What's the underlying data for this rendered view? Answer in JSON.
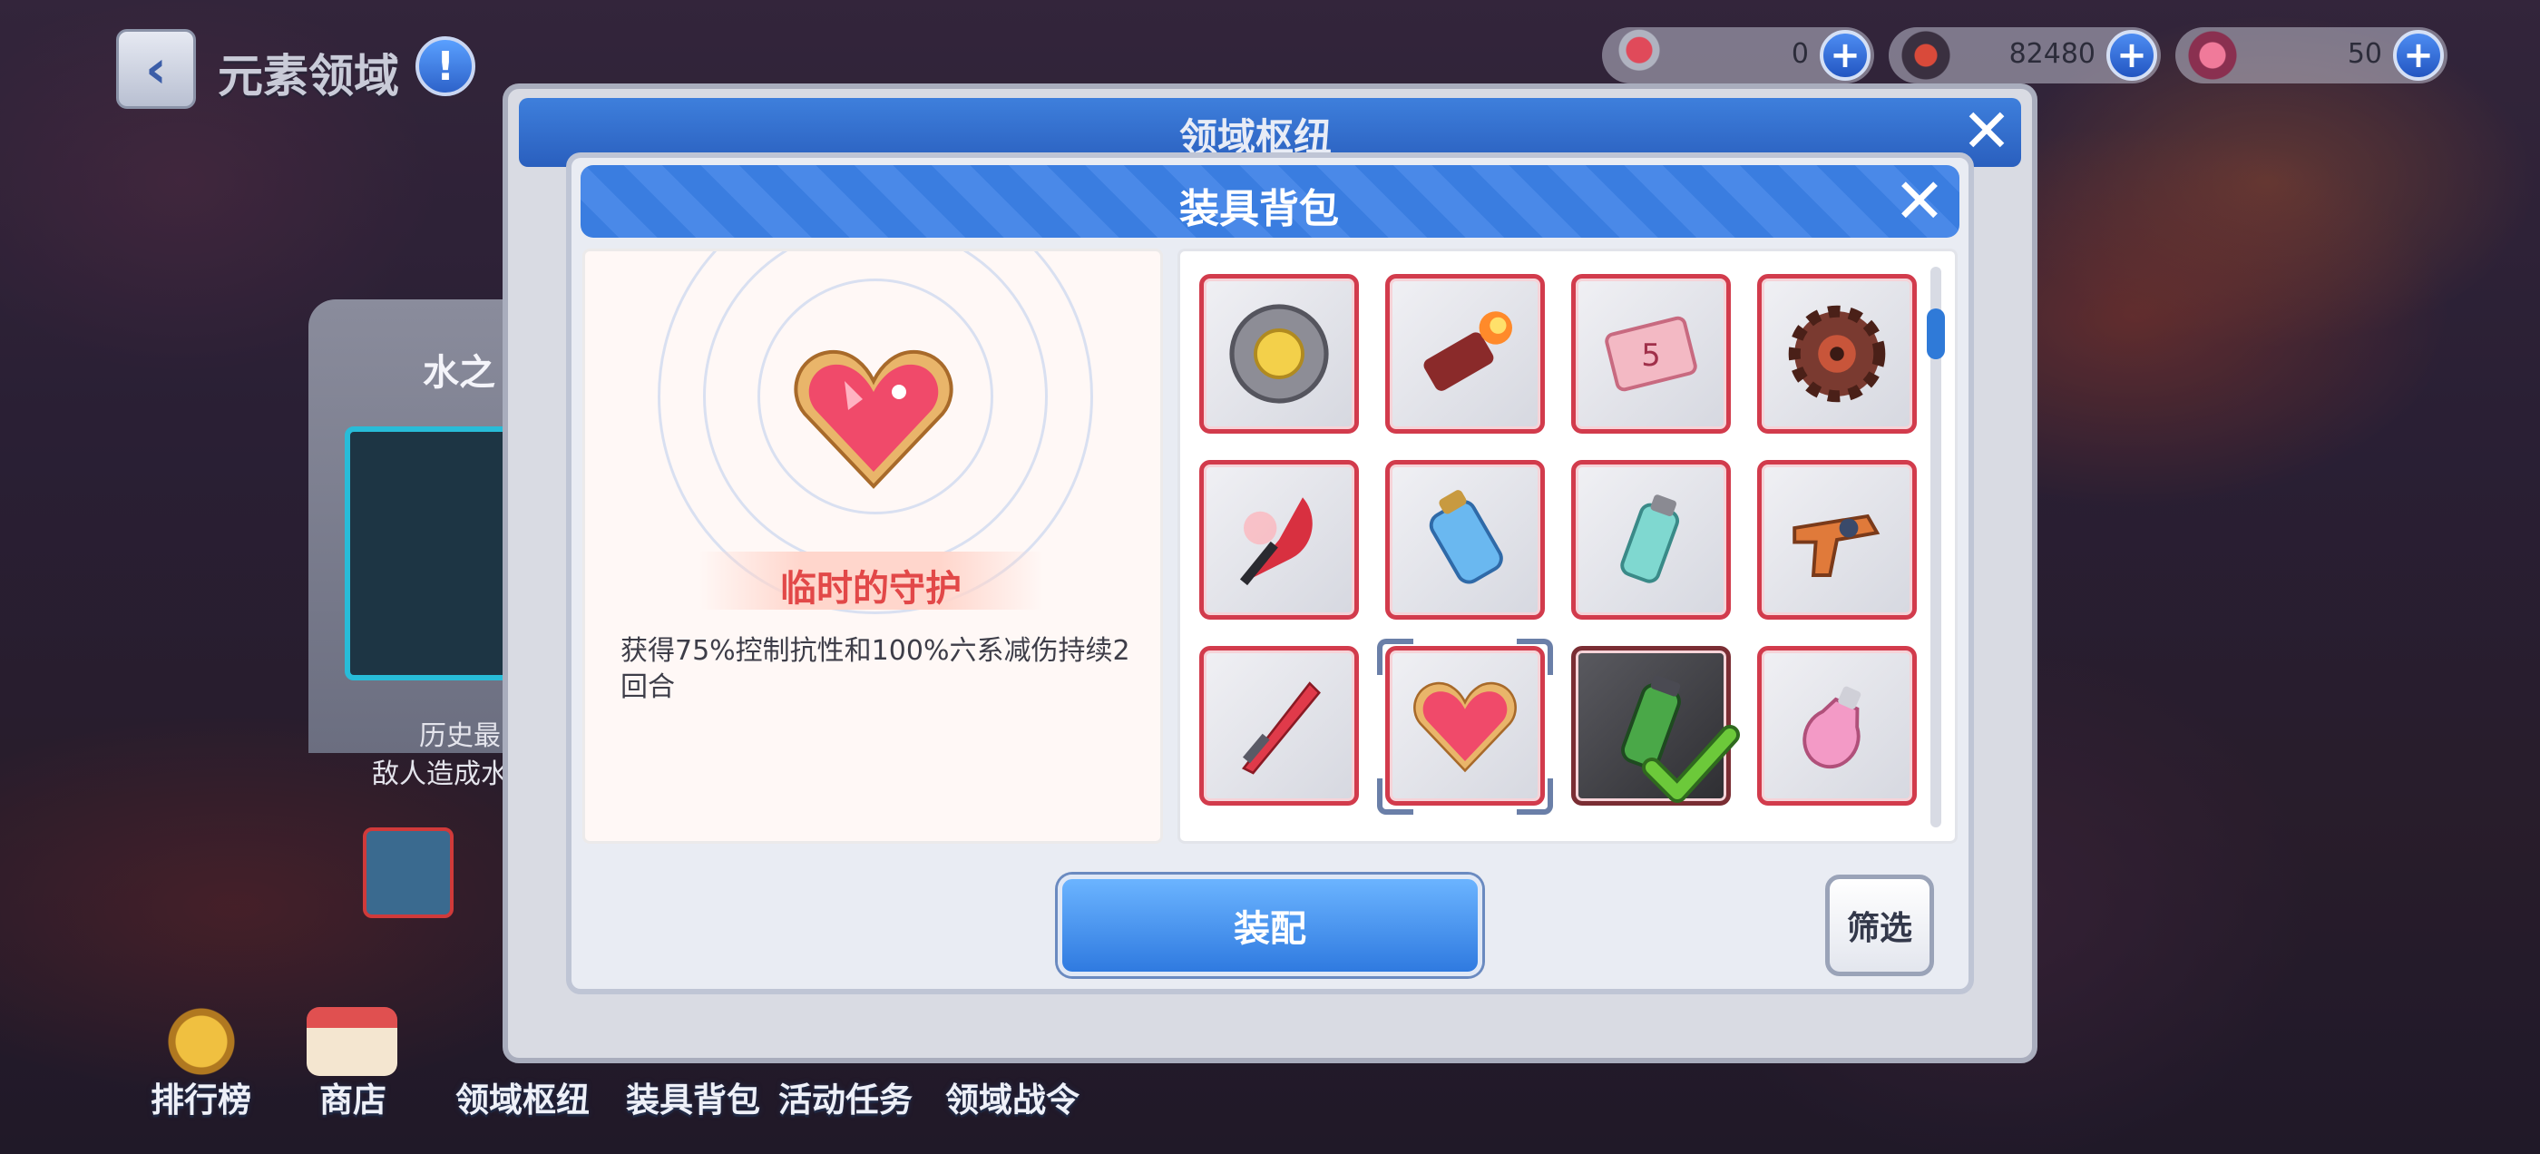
{
  "top_bar": {
    "title": "元素领域",
    "back_icon": "chevron-left-icon",
    "info_icon": "exclamation-icon",
    "currencies": [
      {
        "icon": "key-icon",
        "value": "0"
      },
      {
        "icon": "shield-badge-icon",
        "value": "82480"
      },
      {
        "icon": "gem-icon",
        "value": "50"
      }
    ]
  },
  "background": {
    "hub_title": "领域枢纽",
    "gate_label": "水之",
    "history_text": "历史最",
    "enemy_text": "敌人造成水"
  },
  "bottom_nav": {
    "items": [
      "排行榜",
      "商店",
      "领域枢纽",
      "装具背包",
      "活动任务",
      "领域战令"
    ]
  },
  "modal": {
    "title": "装具背包",
    "close_icon": "close-icon",
    "selected_item": {
      "name": "临时的守护",
      "description": "获得75%控制抗性和100%六系减伤持续2回合",
      "icon": "heart-gem-icon"
    },
    "items": [
      {
        "icon": "coin-disc-icon",
        "state": "normal"
      },
      {
        "icon": "fire-cannon-icon",
        "state": "normal"
      },
      {
        "icon": "ticket-5-icon",
        "state": "normal"
      },
      {
        "icon": "gear-icon",
        "state": "normal"
      },
      {
        "icon": "red-blade-icon",
        "state": "normal"
      },
      {
        "icon": "blue-potion-icon",
        "state": "normal"
      },
      {
        "icon": "battery-icon",
        "state": "normal"
      },
      {
        "icon": "blaster-gun-icon",
        "state": "normal"
      },
      {
        "icon": "crystal-sword-icon",
        "state": "normal"
      },
      {
        "icon": "heart-gem-icon",
        "state": "selected"
      },
      {
        "icon": "green-vial-icon",
        "state": "equipped"
      },
      {
        "icon": "pink-potion-icon",
        "state": "normal"
      }
    ],
    "equip_label": "装配",
    "filter_label": "筛选"
  },
  "colors": {
    "accent_blue": "#2f7ae0",
    "slot_border": "#d23b4c",
    "item_name": "#e24848",
    "check_green": "#6cc93a"
  }
}
